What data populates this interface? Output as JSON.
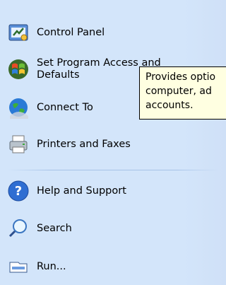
{
  "menu": {
    "items": [
      {
        "label": "Control Panel",
        "icon": "control-panel-icon"
      },
      {
        "label_line1": "Set Program Access and",
        "label_line2": "Defaults",
        "icon": "windows-program-access-icon"
      },
      {
        "label": "Connect To",
        "icon": "connect-to-globe-icon"
      },
      {
        "label": "Printers and Faxes",
        "icon": "printer-icon"
      },
      {
        "label": "Help and Support",
        "icon": "help-icon"
      },
      {
        "label": "Search",
        "icon": "search-icon"
      },
      {
        "label": "Run...",
        "icon": "run-icon"
      }
    ]
  },
  "tooltip": {
    "line1": "Provides optio",
    "line2": "computer, ad",
    "line3": "accounts."
  },
  "colors": {
    "menu_background": "#d3e5fa",
    "tooltip_background": "#ffffe1",
    "separator": "#a7c3e8"
  }
}
